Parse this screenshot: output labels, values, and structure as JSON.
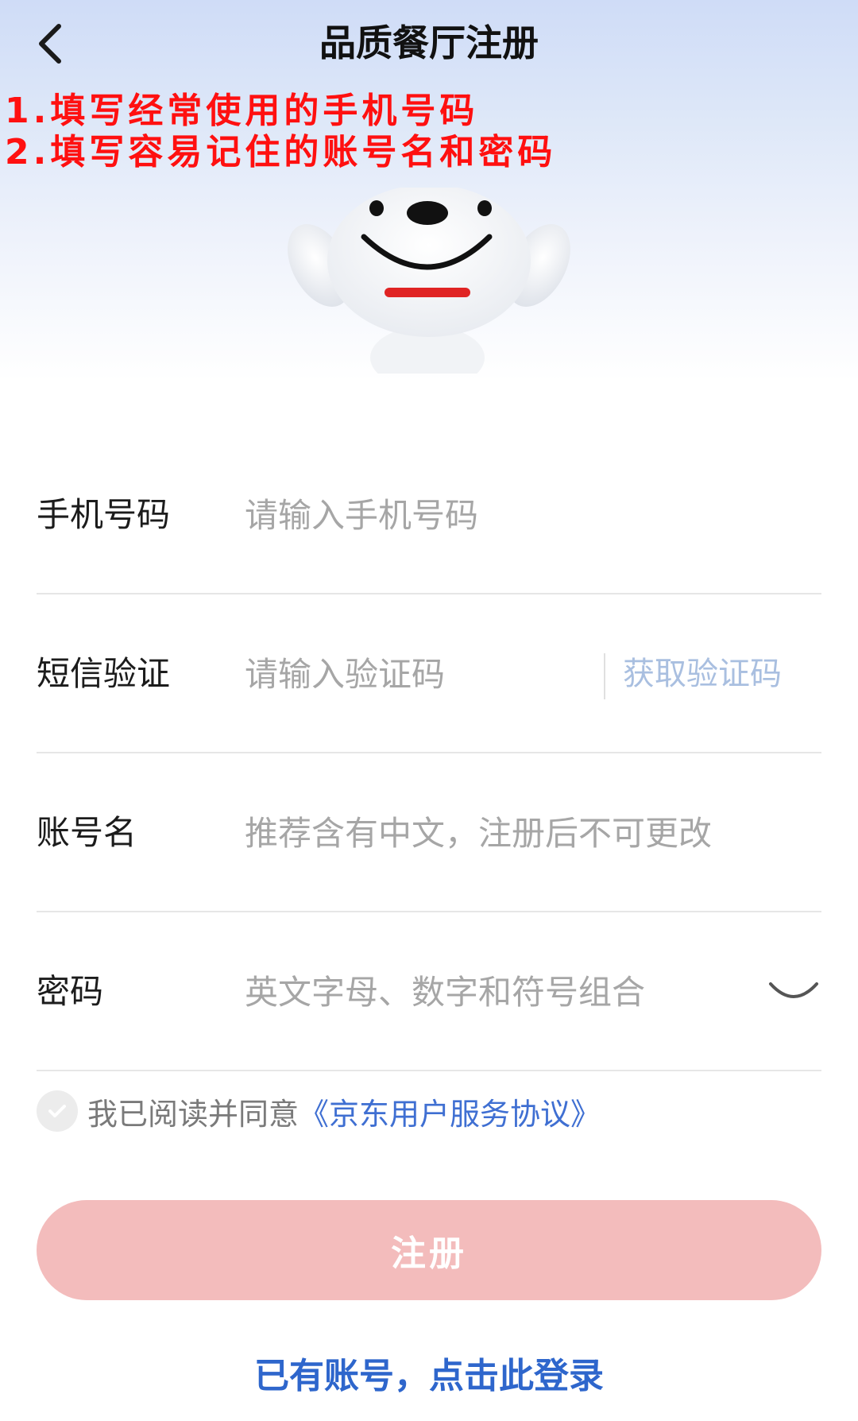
{
  "header": {
    "title": "品质餐厅注册",
    "back_icon": "chevron-left-icon"
  },
  "annotations": {
    "line1": "1.填写经常使用的手机号码",
    "line2": "2.填写容易记住的账号名和密码",
    "color": "#ff1010"
  },
  "mascot": {
    "icon": "dog-mascot-icon"
  },
  "form": {
    "phone": {
      "label": "手机号码",
      "placeholder": "请输入手机号码",
      "value": ""
    },
    "sms": {
      "label": "短信验证",
      "placeholder": "请输入验证码",
      "value": "",
      "get_code_label": "获取验证码"
    },
    "account": {
      "label": "账号名",
      "placeholder": "推荐含有中文，注册后不可更改",
      "value": ""
    },
    "password": {
      "label": "密码",
      "placeholder": "英文字母、数字和符号组合",
      "value": "",
      "toggle_icon": "eye-closed-icon"
    }
  },
  "agreement": {
    "checked": false,
    "text": "我已阅读并同意",
    "link": "《京东用户服务协议》"
  },
  "actions": {
    "register_label": "注册",
    "register_color": "#f3bcbc",
    "login_link": "已有账号，点击此登录",
    "link_color": "#2e66cc"
  }
}
